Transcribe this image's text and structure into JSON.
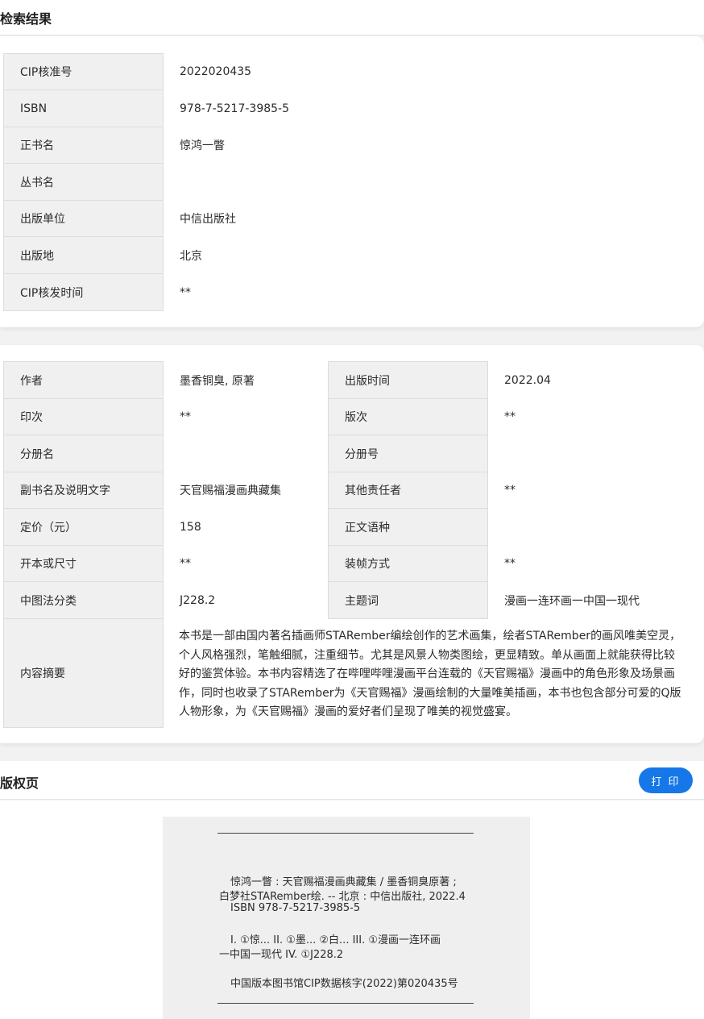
{
  "header": {
    "title": "检索结果"
  },
  "cip_info": {
    "rows": [
      {
        "label": "CIP核准号",
        "value": "2022020435"
      },
      {
        "label": "ISBN",
        "value": "978-7-5217-3985-5"
      },
      {
        "label": "正书名",
        "value": "惊鸿一瞥"
      },
      {
        "label": "丛书名",
        "value": ""
      },
      {
        "label": "出版单位",
        "value": "中信出版社"
      },
      {
        "label": "出版地",
        "value": "北京"
      },
      {
        "label": "CIP核发时间",
        "value": "**"
      }
    ]
  },
  "details": {
    "rows": [
      {
        "label1": "作者",
        "value1": "墨香铜臭, 原著",
        "label2": "出版时间",
        "value2": "2022.04"
      },
      {
        "label1": "印次",
        "value1": "**",
        "label2": "版次",
        "value2": "**"
      },
      {
        "label1": "分册名",
        "value1": "",
        "label2": "分册号",
        "value2": ""
      },
      {
        "label1": "副书名及说明文字",
        "value1": "天官赐福漫画典藏集",
        "label2": "其他责任者",
        "value2": "**"
      },
      {
        "label1": "定价（元）",
        "value1": "158",
        "label2": "正文语种",
        "value2": ""
      },
      {
        "label1": "开本或尺寸",
        "value1": "**",
        "label2": "装帧方式",
        "value2": "**"
      },
      {
        "label1": "中图法分类",
        "value1": "J228.2",
        "label2": "主题词",
        "value2": "漫画一连环画一中国一现代"
      }
    ],
    "abstract_label": "内容摘要",
    "abstract_lines": [
      "本书是一部由国内著名插画师STARember编绘创作的艺术画集，绘者STARember的画风唯美空灵，",
      "个人风格强烈，笔触细腻，注重细节。尤其是风景人物类图绘，更显精致。单从画面上就能获得比较",
      "好的鉴赏体验。本书内容精选了在哔哩哔哩漫画平台连载的《天官赐福》漫画中的角色形象及场景画",
      "作，同时也收录了STARember为《天官赐福》漫画绘制的大量唯美插画，本书也包含部分可爱的Q版",
      "人物形象，为《天官赐福》漫画的爱好者们呈现了唯美的视觉盛宴。"
    ]
  },
  "copyright": {
    "title": "版权页",
    "print_label": "打 印",
    "lines": [
      "惊鸿一瞥 : 天官赐福漫画典藏集 / 墨香铜臭原著 ;",
      "白梦社STARember绘. -- 北京 : 中信出版社, 2022.4",
      "ISBN 978-7-5217-3985-5",
      "I. ①惊... II. ①墨... ②白... III. ①漫画一连环画",
      "一中国一现代 IV. ①J228.2",
      "中国版本图书馆CIP数据核字(2022)第020435号"
    ]
  },
  "colors": {
    "accent": "#1677e8",
    "label_bg": "#f0f0f0",
    "page_bg": "#f2f2f2"
  }
}
